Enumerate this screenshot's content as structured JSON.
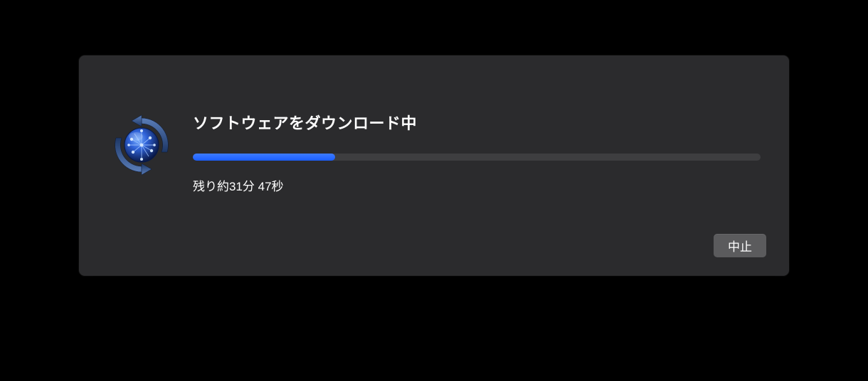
{
  "dialog": {
    "title": "ソフトウェアをダウンロード中",
    "status": "残り約31分 47秒",
    "progress_percent": 25,
    "cancel_label": "中止",
    "icon": "software-update-icon"
  }
}
